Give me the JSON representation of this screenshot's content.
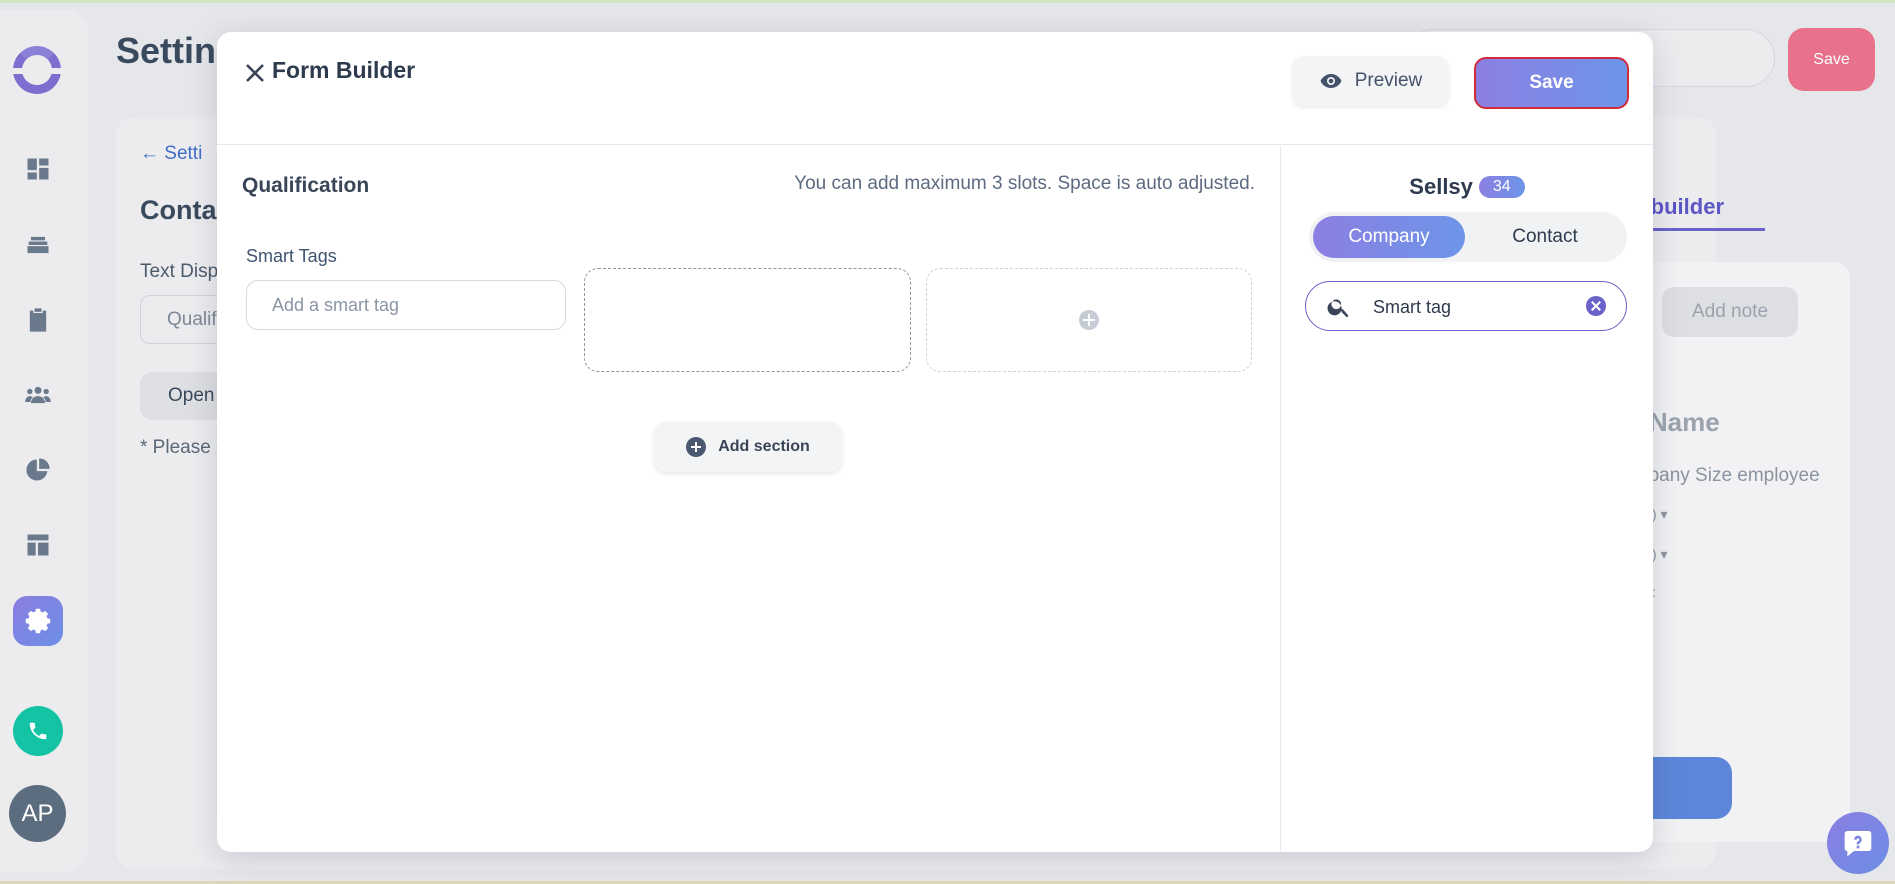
{
  "background": {
    "page_title": "Settin",
    "save_label": "Save",
    "back_label": "Setti",
    "contact_heading": "Conta",
    "text_display_label": "Text Disp",
    "text_display_value": "Qualif",
    "open_label": "Open",
    "note_text": "* Please c",
    "form_builder_tab": "m builder",
    "add_note_label": "Add note",
    "name_heading": "t Name",
    "company_size_label": "npany Size employee",
    "dropdown_1": ") ▾",
    "dropdown_2": ") ▾",
    "dropdown_3": ":",
    "avatar_initials": "AP"
  },
  "sidebar": {
    "items": [
      {
        "icon": "dashboard-icon"
      },
      {
        "icon": "layers-icon"
      },
      {
        "icon": "clipboard-icon"
      },
      {
        "icon": "people-icon"
      },
      {
        "icon": "pie-chart-icon"
      },
      {
        "icon": "layout-icon"
      },
      {
        "icon": "gear-icon",
        "active": true
      }
    ]
  },
  "modal": {
    "title": "Form Builder",
    "preview_label": "Preview",
    "save_label": "Save",
    "section": {
      "title": "Qualification",
      "hint": "You can add maximum 3 slots. Space is auto adjusted.",
      "field_label": "Smart Tags",
      "field_placeholder": "Add a smart tag",
      "add_section_label": "Add section"
    },
    "source": {
      "name": "Sellsy",
      "count": "34",
      "toggle": [
        "Company",
        "Contact"
      ],
      "selected": "Company",
      "search_value": "Smart tag"
    }
  },
  "colors": {
    "accent_start": "#8c7fe2",
    "accent_end": "#6c95e8",
    "save_border": "#d22c3c",
    "call_green": "#14c3a4"
  }
}
